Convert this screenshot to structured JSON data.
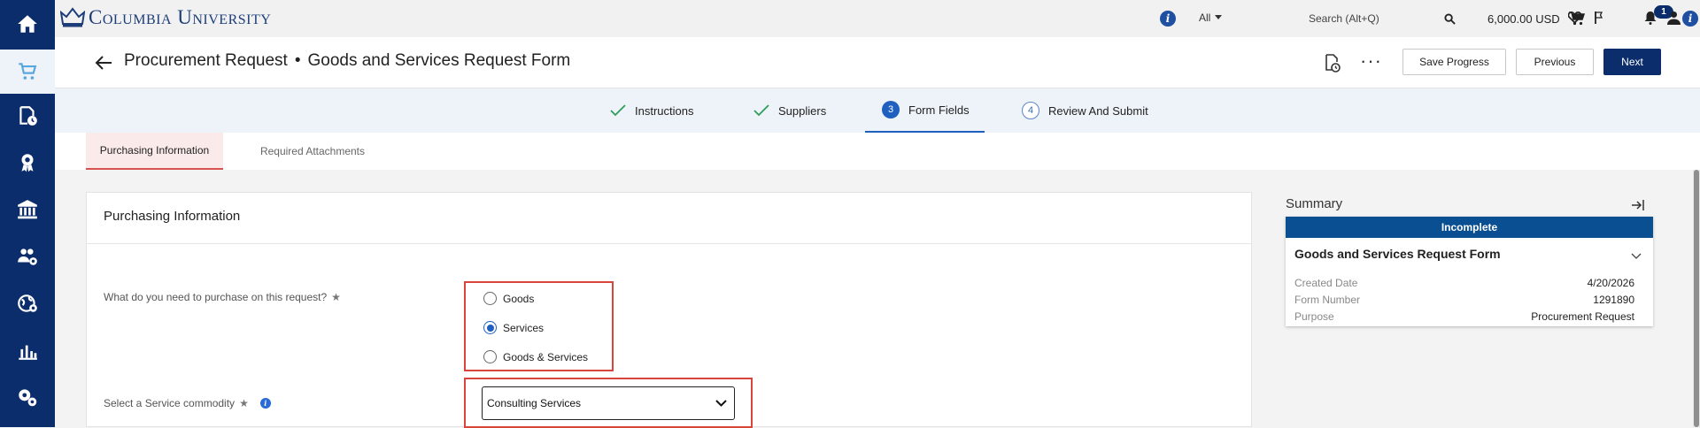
{
  "topbar": {
    "brand": "Columbia University",
    "scope": "All",
    "search_placeholder": "Search (Alt+Q)",
    "cart_total": "6,000.00 USD",
    "notifications_count": "1"
  },
  "header": {
    "title_section": "Procurement Request",
    "title_separator": "•",
    "title_form": "Goods and Services Request Form",
    "save_progress": "Save Progress",
    "previous": "Previous",
    "next": "Next",
    "more": "···"
  },
  "stepper": {
    "steps": [
      {
        "label": "Instructions",
        "state": "complete"
      },
      {
        "label": "Suppliers",
        "state": "complete"
      },
      {
        "label": "Form Fields",
        "num": "3",
        "state": "current"
      },
      {
        "label": "Review And Submit",
        "num": "4",
        "state": "upcoming"
      }
    ]
  },
  "subtabs": [
    {
      "label": "Purchasing Information",
      "active": true
    },
    {
      "label": "Required Attachments",
      "active": false
    }
  ],
  "section": {
    "title": "Purchasing Information",
    "purchase_question": "What do you need to purchase on this request?",
    "purchase_options": [
      {
        "label": "Goods",
        "selected": false
      },
      {
        "label": "Services",
        "selected": true
      },
      {
        "label": "Goods & Services",
        "selected": false
      }
    ],
    "commodity_label": "Select a Service commodity",
    "commodity_value": "Consulting Services"
  },
  "summary": {
    "title": "Summary",
    "status": "Incomplete",
    "form_name": "Goods and Services Request Form",
    "rows": [
      {
        "key": "Created Date",
        "value": "4/20/2026"
      },
      {
        "key": "Form Number",
        "value": "1291890"
      },
      {
        "key": "Purpose",
        "value": "Procurement Request"
      }
    ]
  },
  "colors": {
    "rail": "#0b2d6b",
    "primary_button": "#0b2d6b",
    "accent_blue": "#1f5fbf",
    "status_bar": "#0b4f93",
    "highlight_box": "#d9453c"
  }
}
